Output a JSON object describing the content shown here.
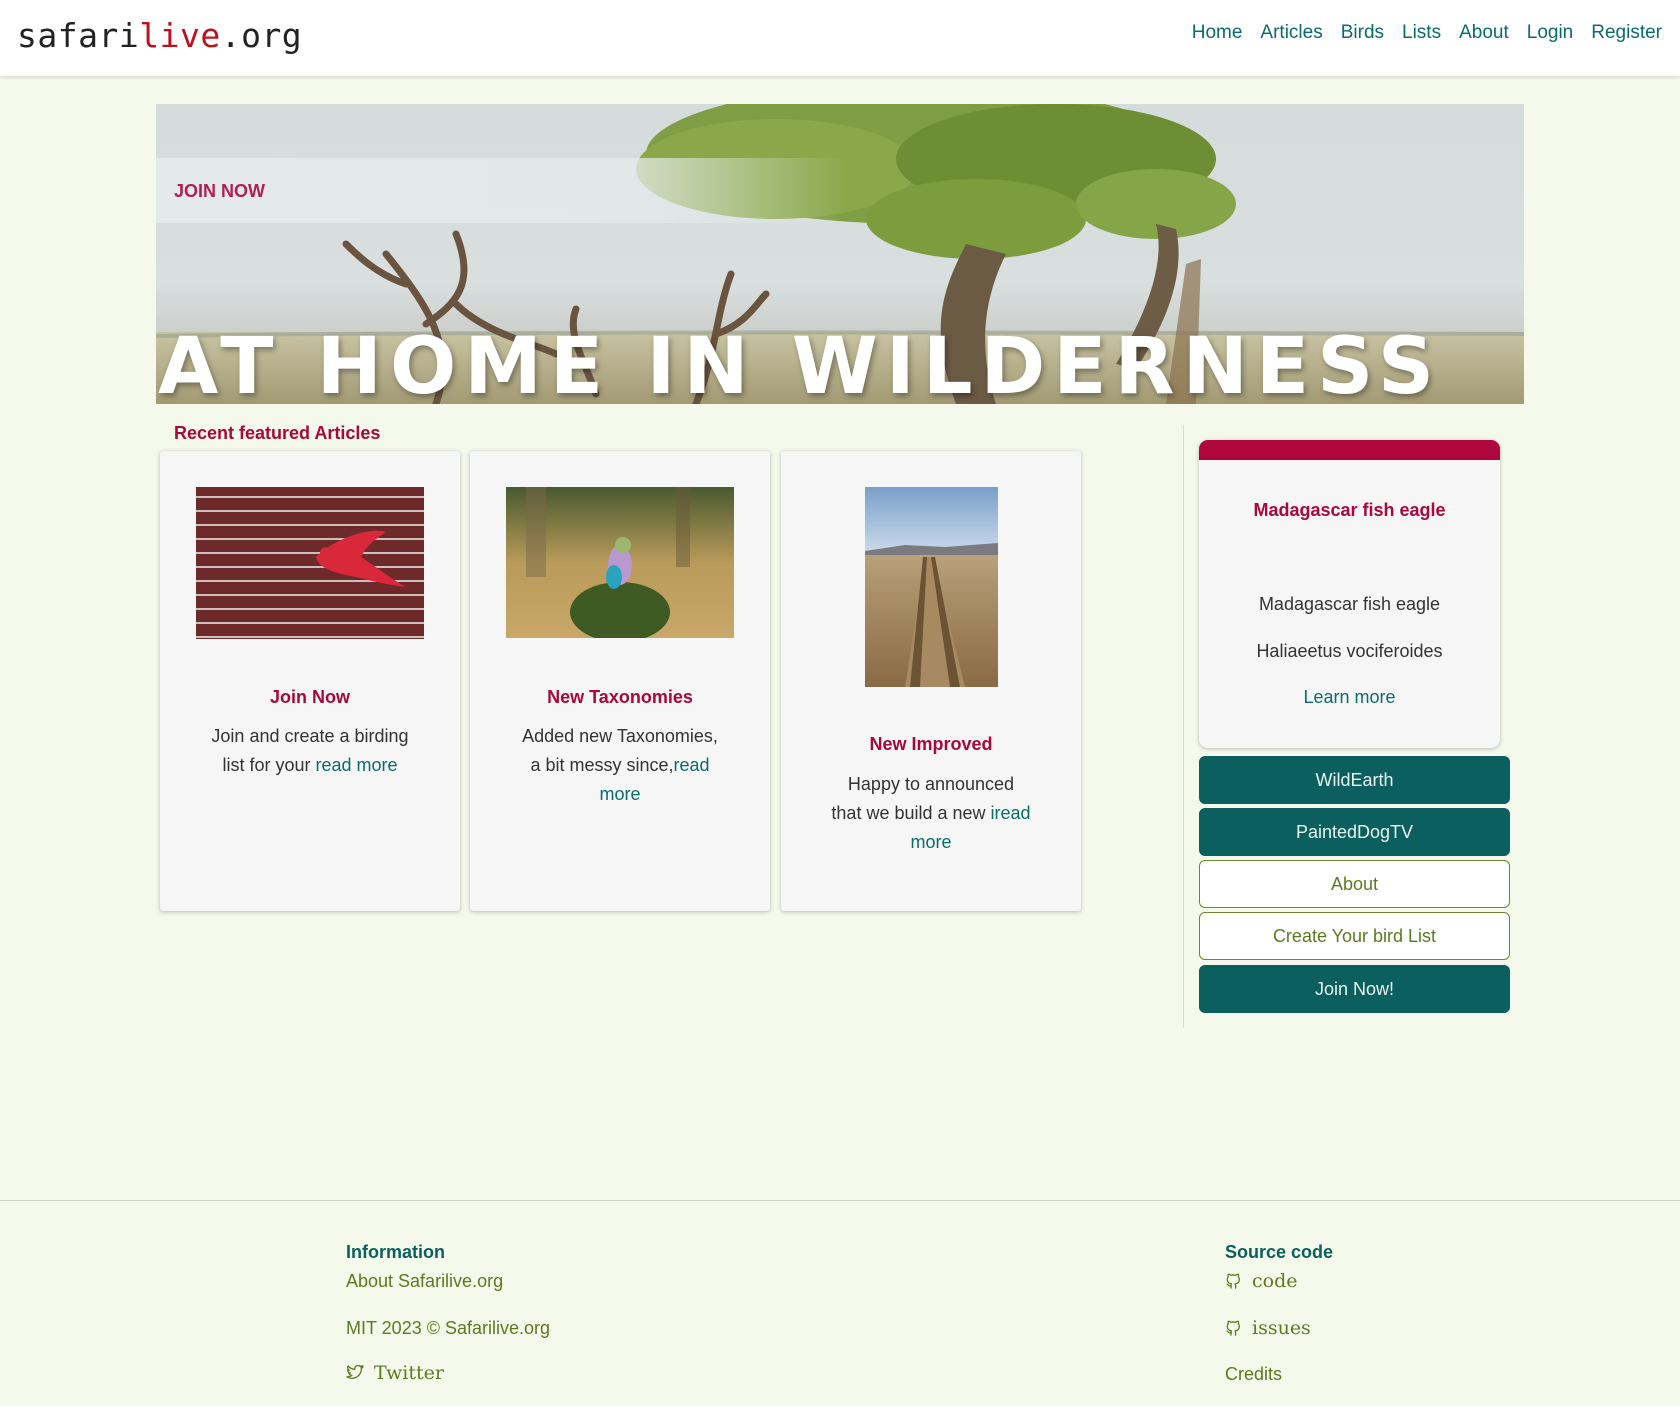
{
  "brand": {
    "part1": "safari",
    "part2": "live",
    "part3": ".org"
  },
  "nav": [
    {
      "label": "Home"
    },
    {
      "label": "Articles"
    },
    {
      "label": "Birds"
    },
    {
      "label": "Lists"
    },
    {
      "label": "About"
    },
    {
      "label": "Login"
    },
    {
      "label": "Register"
    }
  ],
  "hero": {
    "join_label": "JOIN NOW",
    "title": "AT HOME IN WILDERNESS"
  },
  "featured": {
    "title": "Recent featured Articles",
    "cards": [
      {
        "title": "Join Now",
        "text": "Join and create a birding list for your ",
        "link": "read more",
        "image": "red-bird-on-brick-wall"
      },
      {
        "title": "New Taxonomies",
        "text": "Added new Taxonomies, a bit messy since,",
        "link": "read more",
        "image": "lilac-breasted-roller"
      },
      {
        "title": "New Improved",
        "text": "Happy to announced that we build a new ",
        "link": "iread more",
        "image": "dirt-road-landscape"
      }
    ]
  },
  "bird_card": {
    "title": "Madagascar fish eagle",
    "common_name": "Madagascar fish eagle",
    "scientific_name": "Haliaeetus vociferoides",
    "link": "Learn more"
  },
  "sidebar_buttons": [
    {
      "label": "WildEarth",
      "style": "solid"
    },
    {
      "label": "PaintedDogTV",
      "style": "solid"
    },
    {
      "label": "About",
      "style": "outline"
    },
    {
      "label": "Create Your bird List",
      "style": "outline"
    },
    {
      "label": "Join Now!",
      "style": "solid"
    }
  ],
  "footer": {
    "info_heading": "Information",
    "about_link": "About Safarilive.org",
    "copyright": "MIT 2023 © Safarilive.org",
    "twitter": "Twitter",
    "source_heading": "Source code",
    "code": "code",
    "issues": "issues",
    "credits": "Credits",
    "icons": {
      "github": "github-icon",
      "twitter": "twitter-icon"
    }
  },
  "colors": {
    "accent_red": "#a8083a",
    "teal": "#0b5f5f",
    "olive": "#5d7a1f",
    "background": "#f5f9ec"
  }
}
